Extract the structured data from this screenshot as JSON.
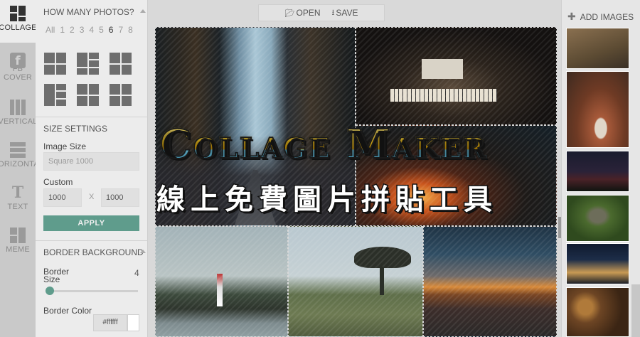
{
  "rail": {
    "items": [
      {
        "label": "COLLAGE",
        "icon": "collage-icon"
      },
      {
        "label": "FB\nCOVER",
        "line1": "FB",
        "line2": "COVER",
        "icon": "facebook-icon"
      },
      {
        "label": "VERTICAL",
        "icon": "vertical-icon"
      },
      {
        "label": "HORIZONTAL",
        "icon": "horizontal-icon"
      },
      {
        "label": "TEXT",
        "icon": "text-icon"
      },
      {
        "label": "MEME",
        "icon": "meme-icon"
      }
    ],
    "fb_glyph": "f",
    "text_glyph": "T"
  },
  "panel": {
    "photos_heading": "HOW MANY PHOTOS?",
    "counts": [
      "All",
      "1",
      "2",
      "3",
      "4",
      "5",
      "6",
      "7",
      "8"
    ],
    "selected_count": "6",
    "size_heading": "SIZE SETTINGS",
    "image_size_label": "Image Size",
    "image_size_value": "Square 1000",
    "custom_label": "Custom",
    "width_value": "1000",
    "x_label": "X",
    "height_value": "1000",
    "apply_label": "APPLY",
    "border_heading": "BORDER BACKGROUND",
    "border_size_label": "Border\nSize",
    "border_size_l1": "Border",
    "border_size_l2": "Size",
    "border_size_value": "4",
    "border_size_fraction": 0.0,
    "border_color_label": "Border Color",
    "border_color_value": "#ffffff"
  },
  "toolbar": {
    "open_label": "OPEN",
    "save_label": "SAVE"
  },
  "banner": {
    "title": "Collage Maker",
    "subtitle": "線上免費圖片拼貼工具"
  },
  "sidebar_right": {
    "add_images_label": "ADD IMAGES"
  },
  "colors": {
    "accent": "#5f9c8c",
    "title_gold": "#f2c22a"
  }
}
